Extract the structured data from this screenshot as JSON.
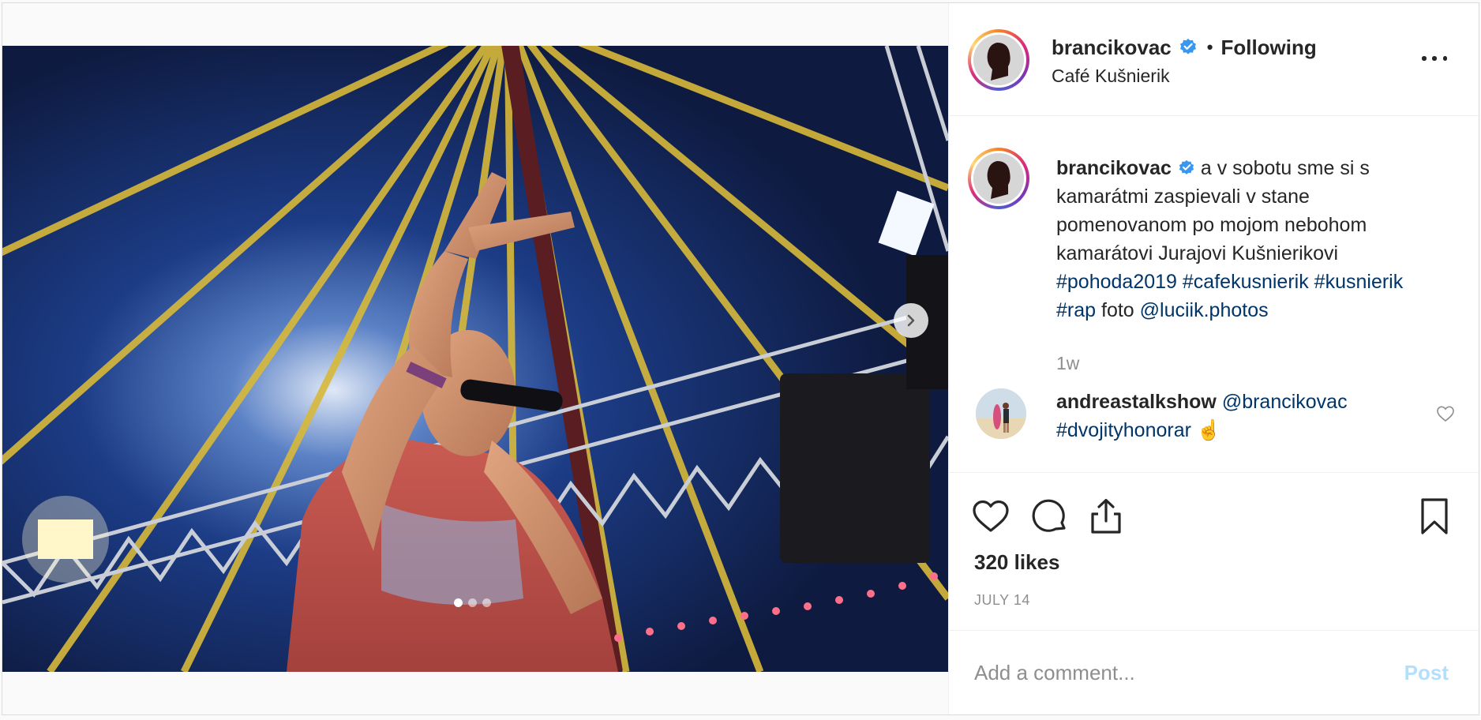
{
  "post": {
    "author": {
      "username": "brancikovac",
      "verified": true,
      "follow_state": "Following",
      "separator": "•",
      "location": "Café Kušnierik"
    },
    "media": {
      "carousel_count": 3,
      "active_index": 0,
      "description_icon": "photo"
    },
    "caption": {
      "username": "brancikovac",
      "text_before_tags": " a v sobotu sme si s kamarátmi zaspievali v stane pomenovanom po mojom nebohom kamarátovi Jurajovi Kušnierikovi ",
      "tags": [
        "#pohoda2019",
        "#cafekusnierik",
        "#kusnierik",
        "#rap"
      ],
      "photo_credit_label": "foto",
      "mention": "@luciik.photos",
      "timestamp": "1w"
    },
    "comments": [
      {
        "username": "andreastalkshow",
        "mention": "@brancikovac",
        "tag": "#dvojityhonorar",
        "emoji": "☝️"
      }
    ],
    "likes_text": "320 likes",
    "date_text": "JULY 14",
    "add_comment": {
      "placeholder": "Add a comment...",
      "value": "",
      "post_label": "Post"
    }
  },
  "colors": {
    "link": "#003569",
    "secondary_text": "#8e8e8e",
    "post_disabled": "#b2dffc",
    "verified": "#3897f0"
  }
}
